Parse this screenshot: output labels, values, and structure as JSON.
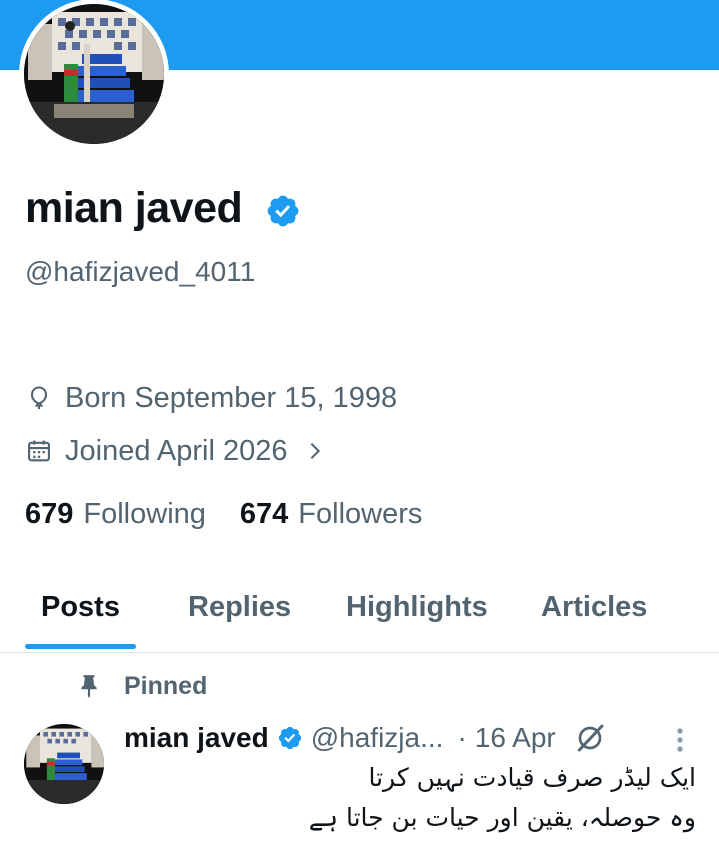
{
  "profile": {
    "display_name": "mian javed",
    "handle": "@hafizjaved_4011",
    "born": "Born September 15, 1998",
    "joined": "Joined April 2026",
    "following_count": "679",
    "following_label": "Following",
    "followers_count": "674",
    "followers_label": "Followers"
  },
  "tabs": [
    {
      "label": "Posts",
      "active": true
    },
    {
      "label": "Replies",
      "active": false
    },
    {
      "label": "Highlights",
      "active": false
    },
    {
      "label": "Articles",
      "active": false
    }
  ],
  "post": {
    "pinned_label": "Pinned",
    "author_name": "mian javed",
    "author_handle": "@hafizja...",
    "date": "16 Apr",
    "text_line1": "ایک لیڈر صرف قیادت نہیں کرتا",
    "text_line2": "وہ حوصلہ، یقین اور حیات بن جاتا ہے"
  },
  "colors": {
    "accent": "#1d9bf0",
    "text_primary": "#0f1419",
    "text_secondary": "#536471"
  },
  "icons": {
    "verified": "verified-badge-icon",
    "born": "balloon-icon",
    "joined": "calendar-icon",
    "chevron": "chevron-right-icon",
    "pin": "pin-icon",
    "grok": "grok-icon",
    "more": "more-vertical-icon"
  }
}
